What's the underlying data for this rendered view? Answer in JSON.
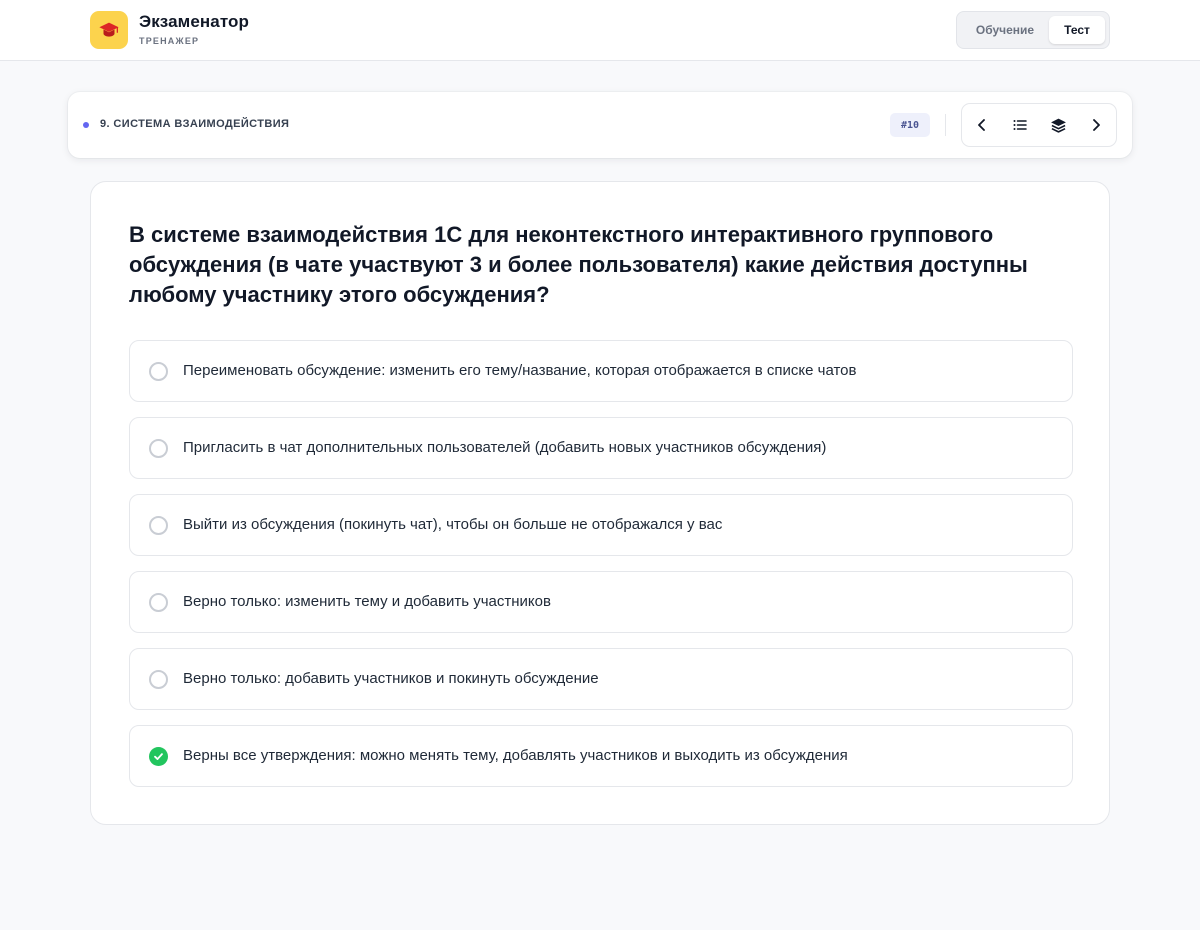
{
  "app": {
    "title": "Экзаменатор",
    "subtitle": "ТРЕНАЖЕР",
    "logo_icon": "graduation-cap-icon",
    "brand_color": "#fcd34d"
  },
  "mode_switch": {
    "learn_label": "Обучение",
    "test_label": "Тест",
    "active": "Тест"
  },
  "topic_bar": {
    "topic": "9. СИСТЕМА ВЗАИМОДЕЙСТВИЯ",
    "question_number": "#10",
    "nav": [
      {
        "name": "prev-button",
        "icon": "chevron-left-icon"
      },
      {
        "name": "list-button",
        "icon": "list-icon"
      },
      {
        "name": "layers-button",
        "icon": "layers-icon"
      },
      {
        "name": "next-button",
        "icon": "chevron-right-icon"
      }
    ]
  },
  "question": {
    "text": "В системе взаимодействия 1С для неконтекстного интерактивного группового обсуждения (в чате участвуют 3 и более пользователя) какие действия доступны любому участнику этого обсуждения?",
    "options": [
      {
        "text": "Переименовать обсуждение: изменить его тему/название, которая отображается в списке чатов",
        "checked": false
      },
      {
        "text": "Пригласить в чат дополнительных пользователей (добавить новых участников обсуждения)",
        "checked": false
      },
      {
        "text": "Выйти из обсуждения (покинуть чат), чтобы он больше не отображался у вас",
        "checked": false
      },
      {
        "text": "Верно только: изменить тему и добавить участников",
        "checked": false
      },
      {
        "text": "Верно только: добавить участников и покинуть обсуждение",
        "checked": false
      },
      {
        "text": "Верны все утверждения: можно менять тему, добавлять участников и выходить из обсуждения",
        "checked": true
      }
    ],
    "correct_color": "#22c55e"
  }
}
